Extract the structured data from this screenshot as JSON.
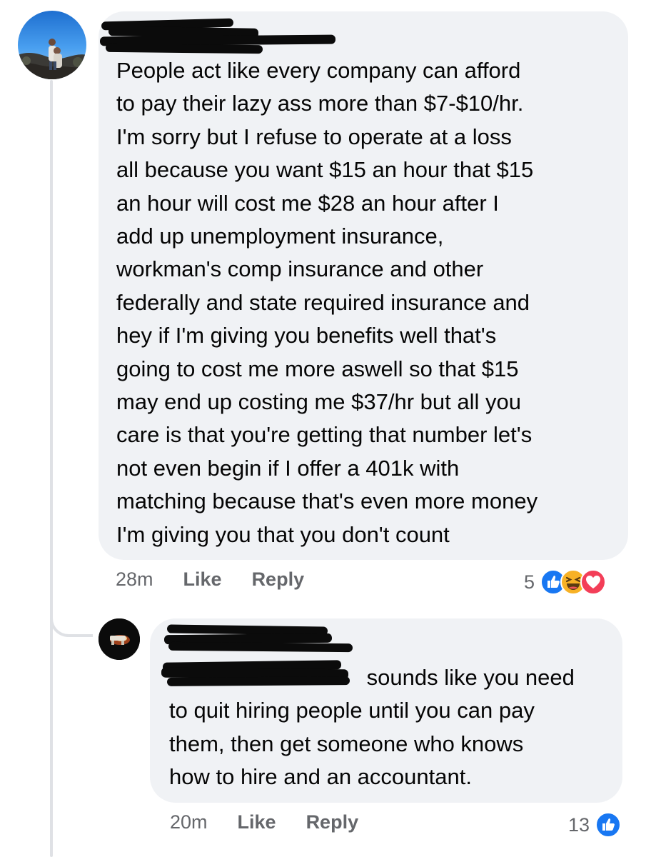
{
  "comments": [
    {
      "text": "People act like every company can afford\nto pay their lazy ass more than $7-$10/hr.\nI'm sorry but I refuse to operate at a loss\nall because you want $15 an hour that $15\nan hour will cost me $28 an hour after I\nadd up unemployment insurance,\nworkman's comp insurance and other\nfederally and state required insurance and\nhey if I'm giving you benefits well that's\ngoing to cost me more aswell so that $15\nmay end up costing me $37/hr but all you\ncare is that you're getting that number let's\nnot even begin if I offer a 401k with\nmatching because that's even more money\nI'm giving you that you don't count",
      "time": "28m",
      "like_label": "Like",
      "reply_label": "Reply",
      "reaction_count": "5",
      "reactions": [
        "like-icon",
        "haha-icon",
        "love-icon"
      ]
    },
    {
      "text_line1": " sounds like you need",
      "text_rest": "to quit hiring people until you can pay\nthem, then get someone who knows\nhow to hire and an accountant.",
      "time": "20m",
      "like_label": "Like",
      "reply_label": "Reply",
      "reaction_count": "13",
      "reactions": [
        "like-icon"
      ]
    }
  ],
  "colors": {
    "bubble": "#f0f2f5",
    "text": "#050505",
    "meta": "#65676b",
    "like_blue": "#1877f2",
    "love_red": "#f33e58",
    "haha_yellow": "#f7b125"
  }
}
